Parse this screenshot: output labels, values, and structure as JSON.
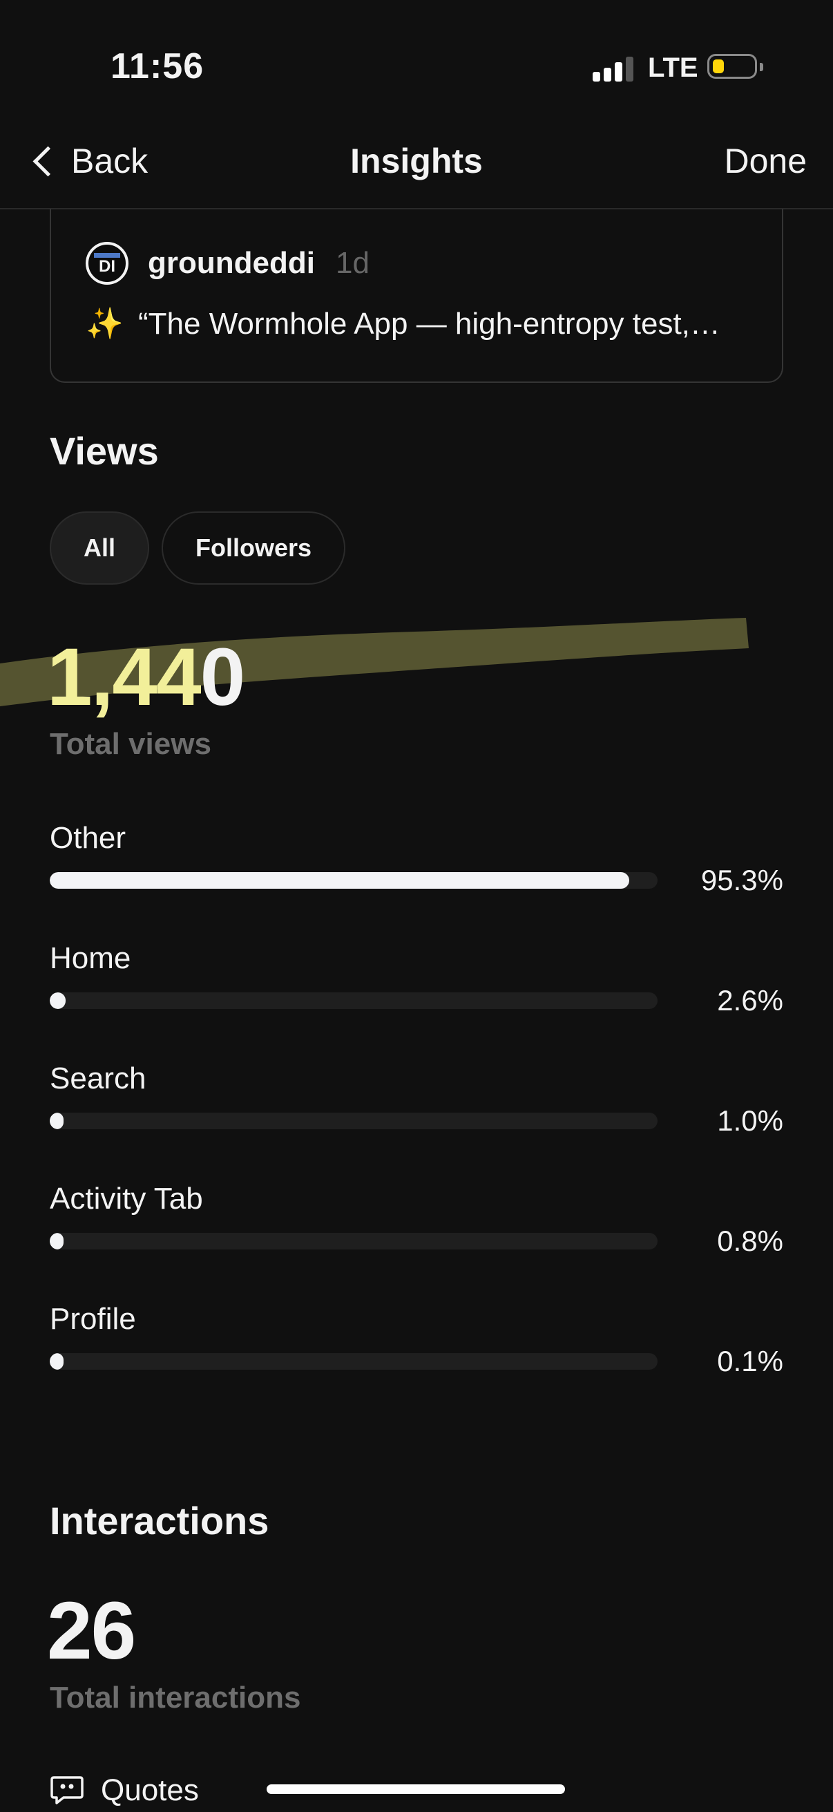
{
  "status_bar": {
    "time": "11:56",
    "network": "LTE"
  },
  "nav": {
    "back_label": "Back",
    "title": "Insights",
    "done_label": "Done"
  },
  "post": {
    "username": "groundeddi",
    "time_ago": "1d",
    "avatar_initials": "DI",
    "emoji": "✨",
    "excerpt": "“The Wormhole App — high-entropy test,…"
  },
  "views": {
    "title": "Views",
    "filters": [
      {
        "label": "All",
        "selected": true
      },
      {
        "label": "Followers",
        "selected": false
      }
    ],
    "total": "1,440",
    "total_label": "Total views",
    "breakdown": [
      {
        "label": "Other",
        "percent": "95.3%",
        "value": 95.3
      },
      {
        "label": "Home",
        "percent": "2.6%",
        "value": 2.6
      },
      {
        "label": "Search",
        "percent": "1.0%",
        "value": 1.0
      },
      {
        "label": "Activity Tab",
        "percent": "0.8%",
        "value": 0.8
      },
      {
        "label": "Profile",
        "percent": "0.1%",
        "value": 0.1
      }
    ]
  },
  "interactions": {
    "title": "Interactions",
    "total": "26",
    "total_label": "Total interactions",
    "first_item_label": "Quotes"
  },
  "colors": {
    "background": "#101010",
    "bar_fill": "#f3f4f6",
    "bar_track": "#1f1f1f",
    "highlight": "#c8c566"
  }
}
